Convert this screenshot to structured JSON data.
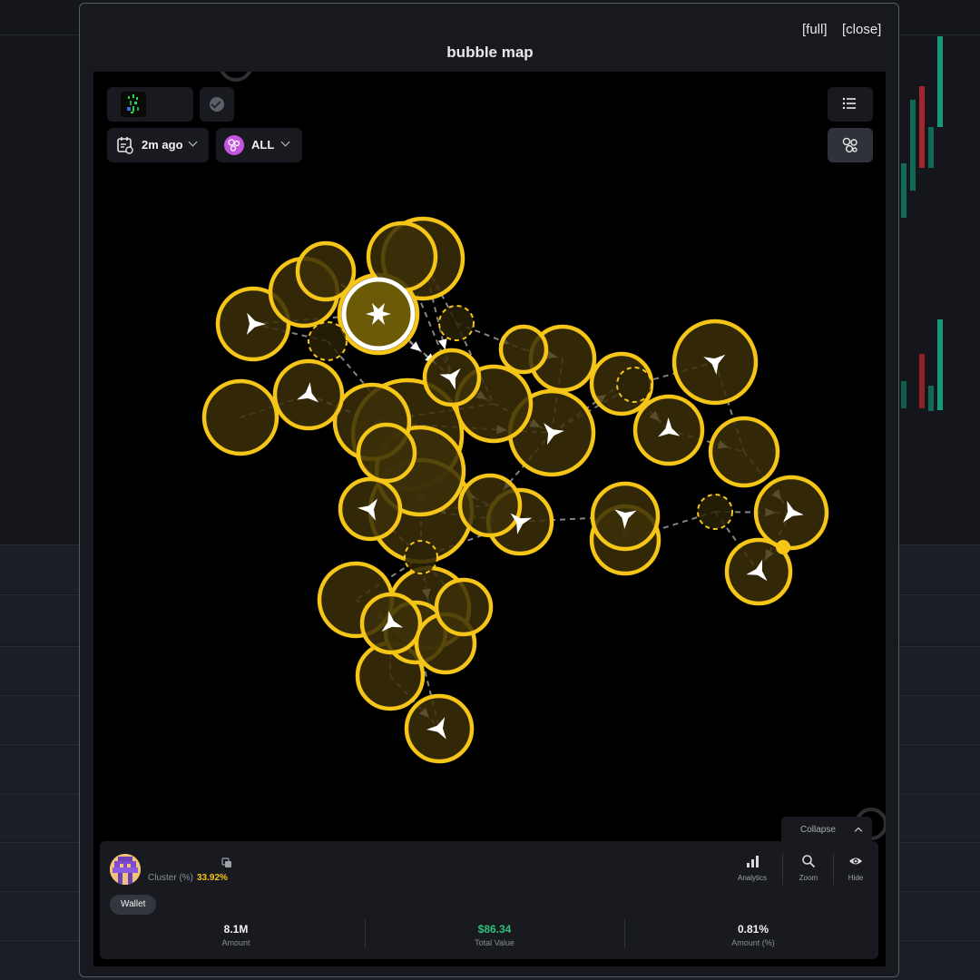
{
  "modal": {
    "title": "bubble map",
    "full_label": "[full]",
    "close_label": "[close]"
  },
  "controls": {
    "time_filter": "2m ago",
    "chain_filter": "ALL"
  },
  "info_panel": {
    "collapse_label": "Collapse",
    "cluster_label": "Cluster (%)",
    "cluster_value": "33.92%",
    "wallet_chip": "Wallet",
    "actions": [
      {
        "label": "Analytics",
        "icon": "bar-chart-icon"
      },
      {
        "label": "Zoom",
        "icon": "search-icon"
      },
      {
        "label": "Hide",
        "icon": "eye-icon"
      }
    ],
    "stats": [
      {
        "value": "8.1M",
        "label": "Amount"
      },
      {
        "value": "$86.34",
        "label": "Total Value"
      },
      {
        "value": "0.81%",
        "label": "Amount (%)"
      }
    ]
  },
  "colors": {
    "bubble_stroke": "#f5c518",
    "bubble_fill": "#3b2f08",
    "highlight_stroke": "#ffffff",
    "link": "#9a9a9a",
    "total_value": "#2fbf7a",
    "cluster_value": "#f5c518",
    "chain_icon": "#c356e0"
  }
}
